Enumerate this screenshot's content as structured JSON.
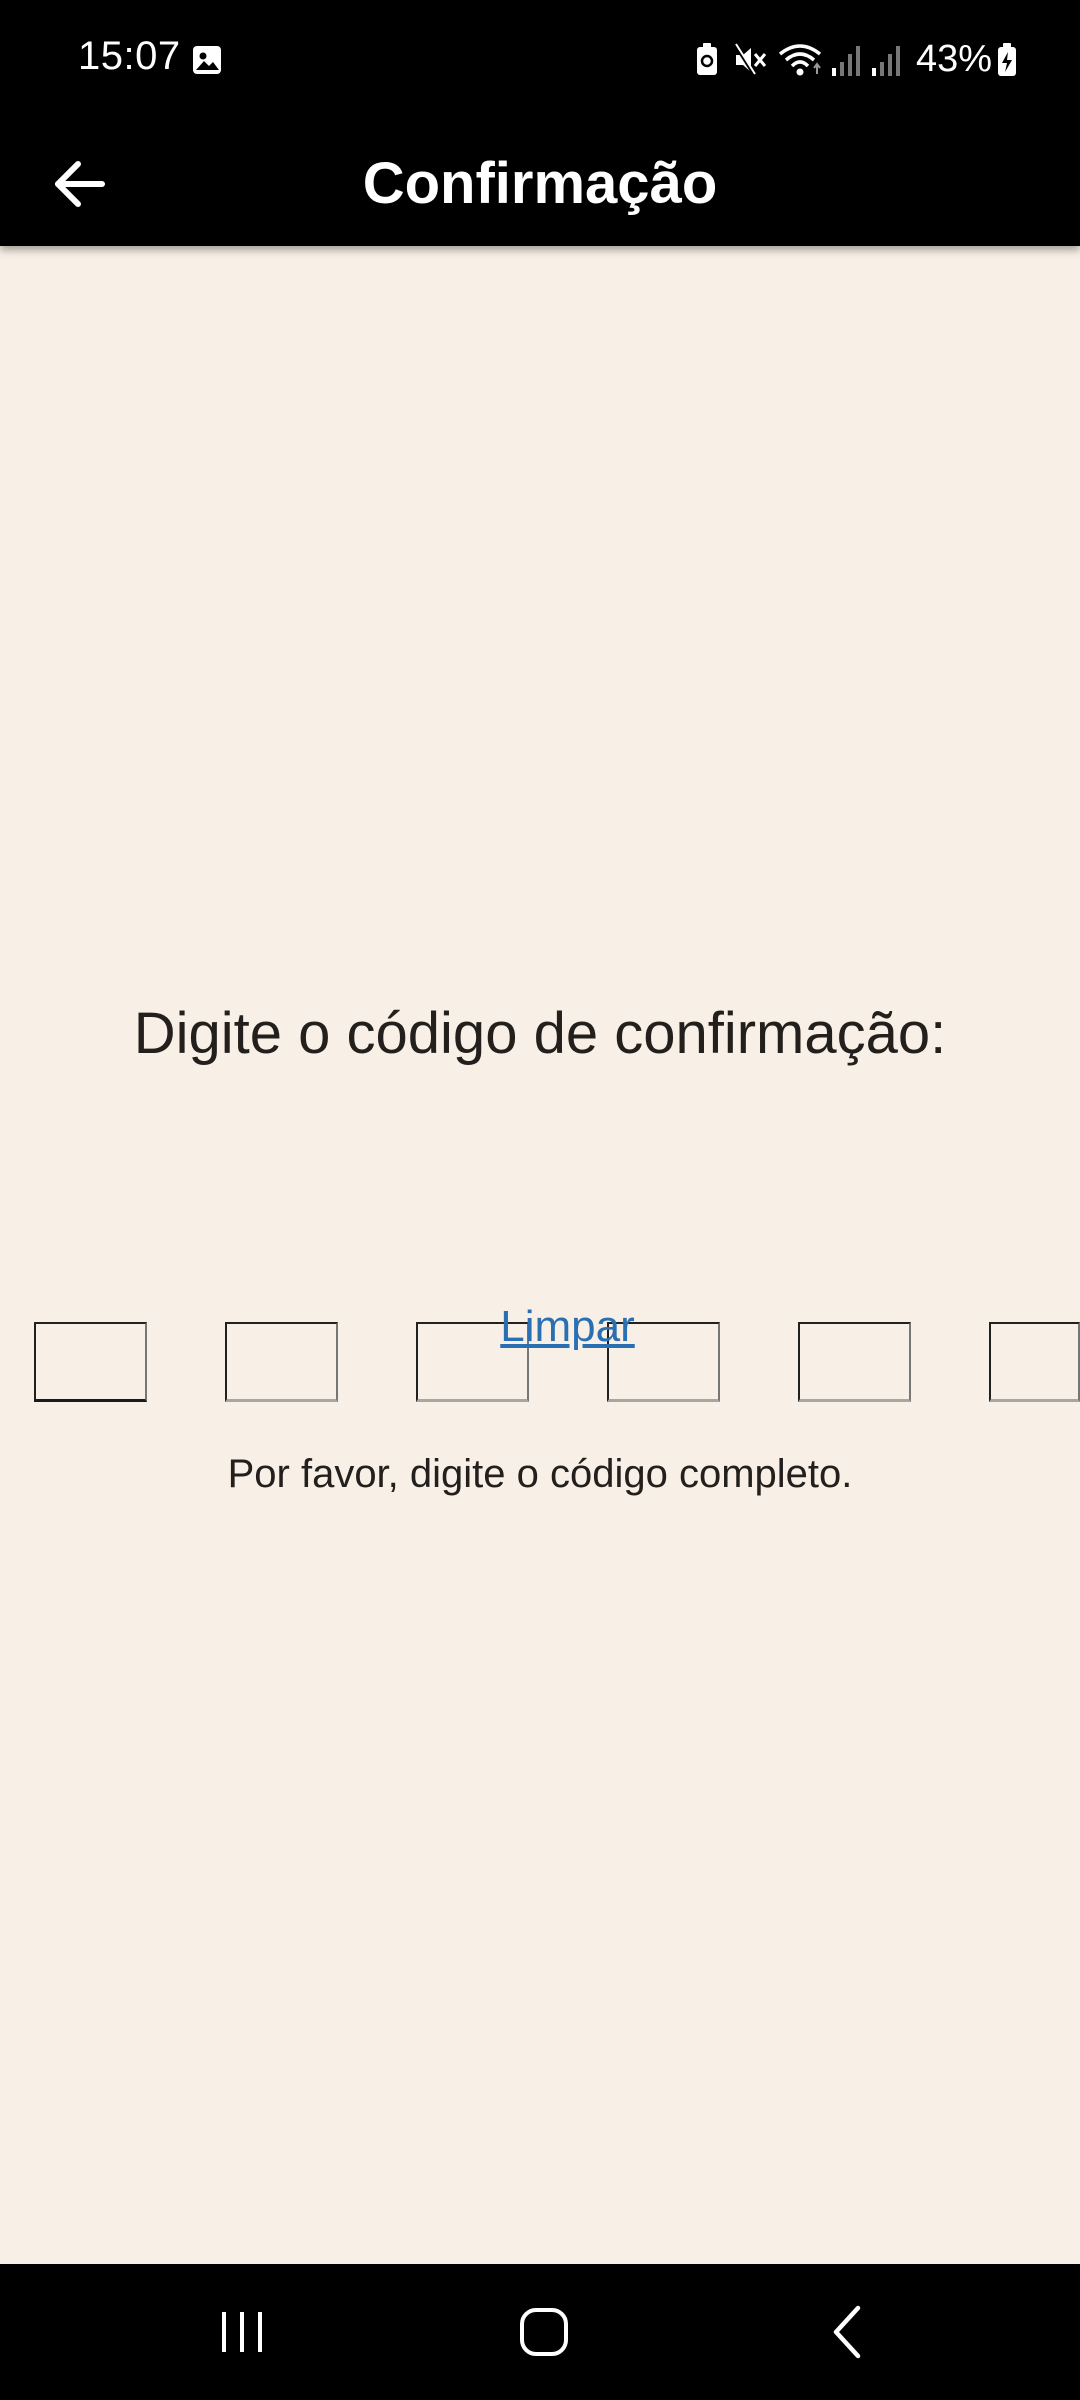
{
  "status_bar": {
    "time": "15:07",
    "battery": "43%",
    "icons": [
      "image-icon",
      "battery-saver-icon",
      "mute-icon",
      "wifi-icon",
      "signal-icon",
      "signal-icon-2",
      "battery-charging-icon"
    ]
  },
  "app_bar": {
    "title": "Confirmação",
    "back_icon": "arrow-left-icon"
  },
  "main": {
    "prompt": "Digite o código de confirmação:",
    "code_slots": [
      "",
      "",
      "",
      "",
      "",
      ""
    ],
    "clear_label": "Limpar",
    "message": "Por favor, digite o código completo."
  },
  "nav_bar": {
    "buttons": [
      "recents-icon",
      "home-icon",
      "back-icon"
    ]
  },
  "colors": {
    "background": "#f8f0e6",
    "bars": "#000000",
    "link": "#2b6fb3",
    "text": "#221f1c",
    "slot_active": "#1a1a1a",
    "slot_inactive": "#a9a5a0"
  }
}
